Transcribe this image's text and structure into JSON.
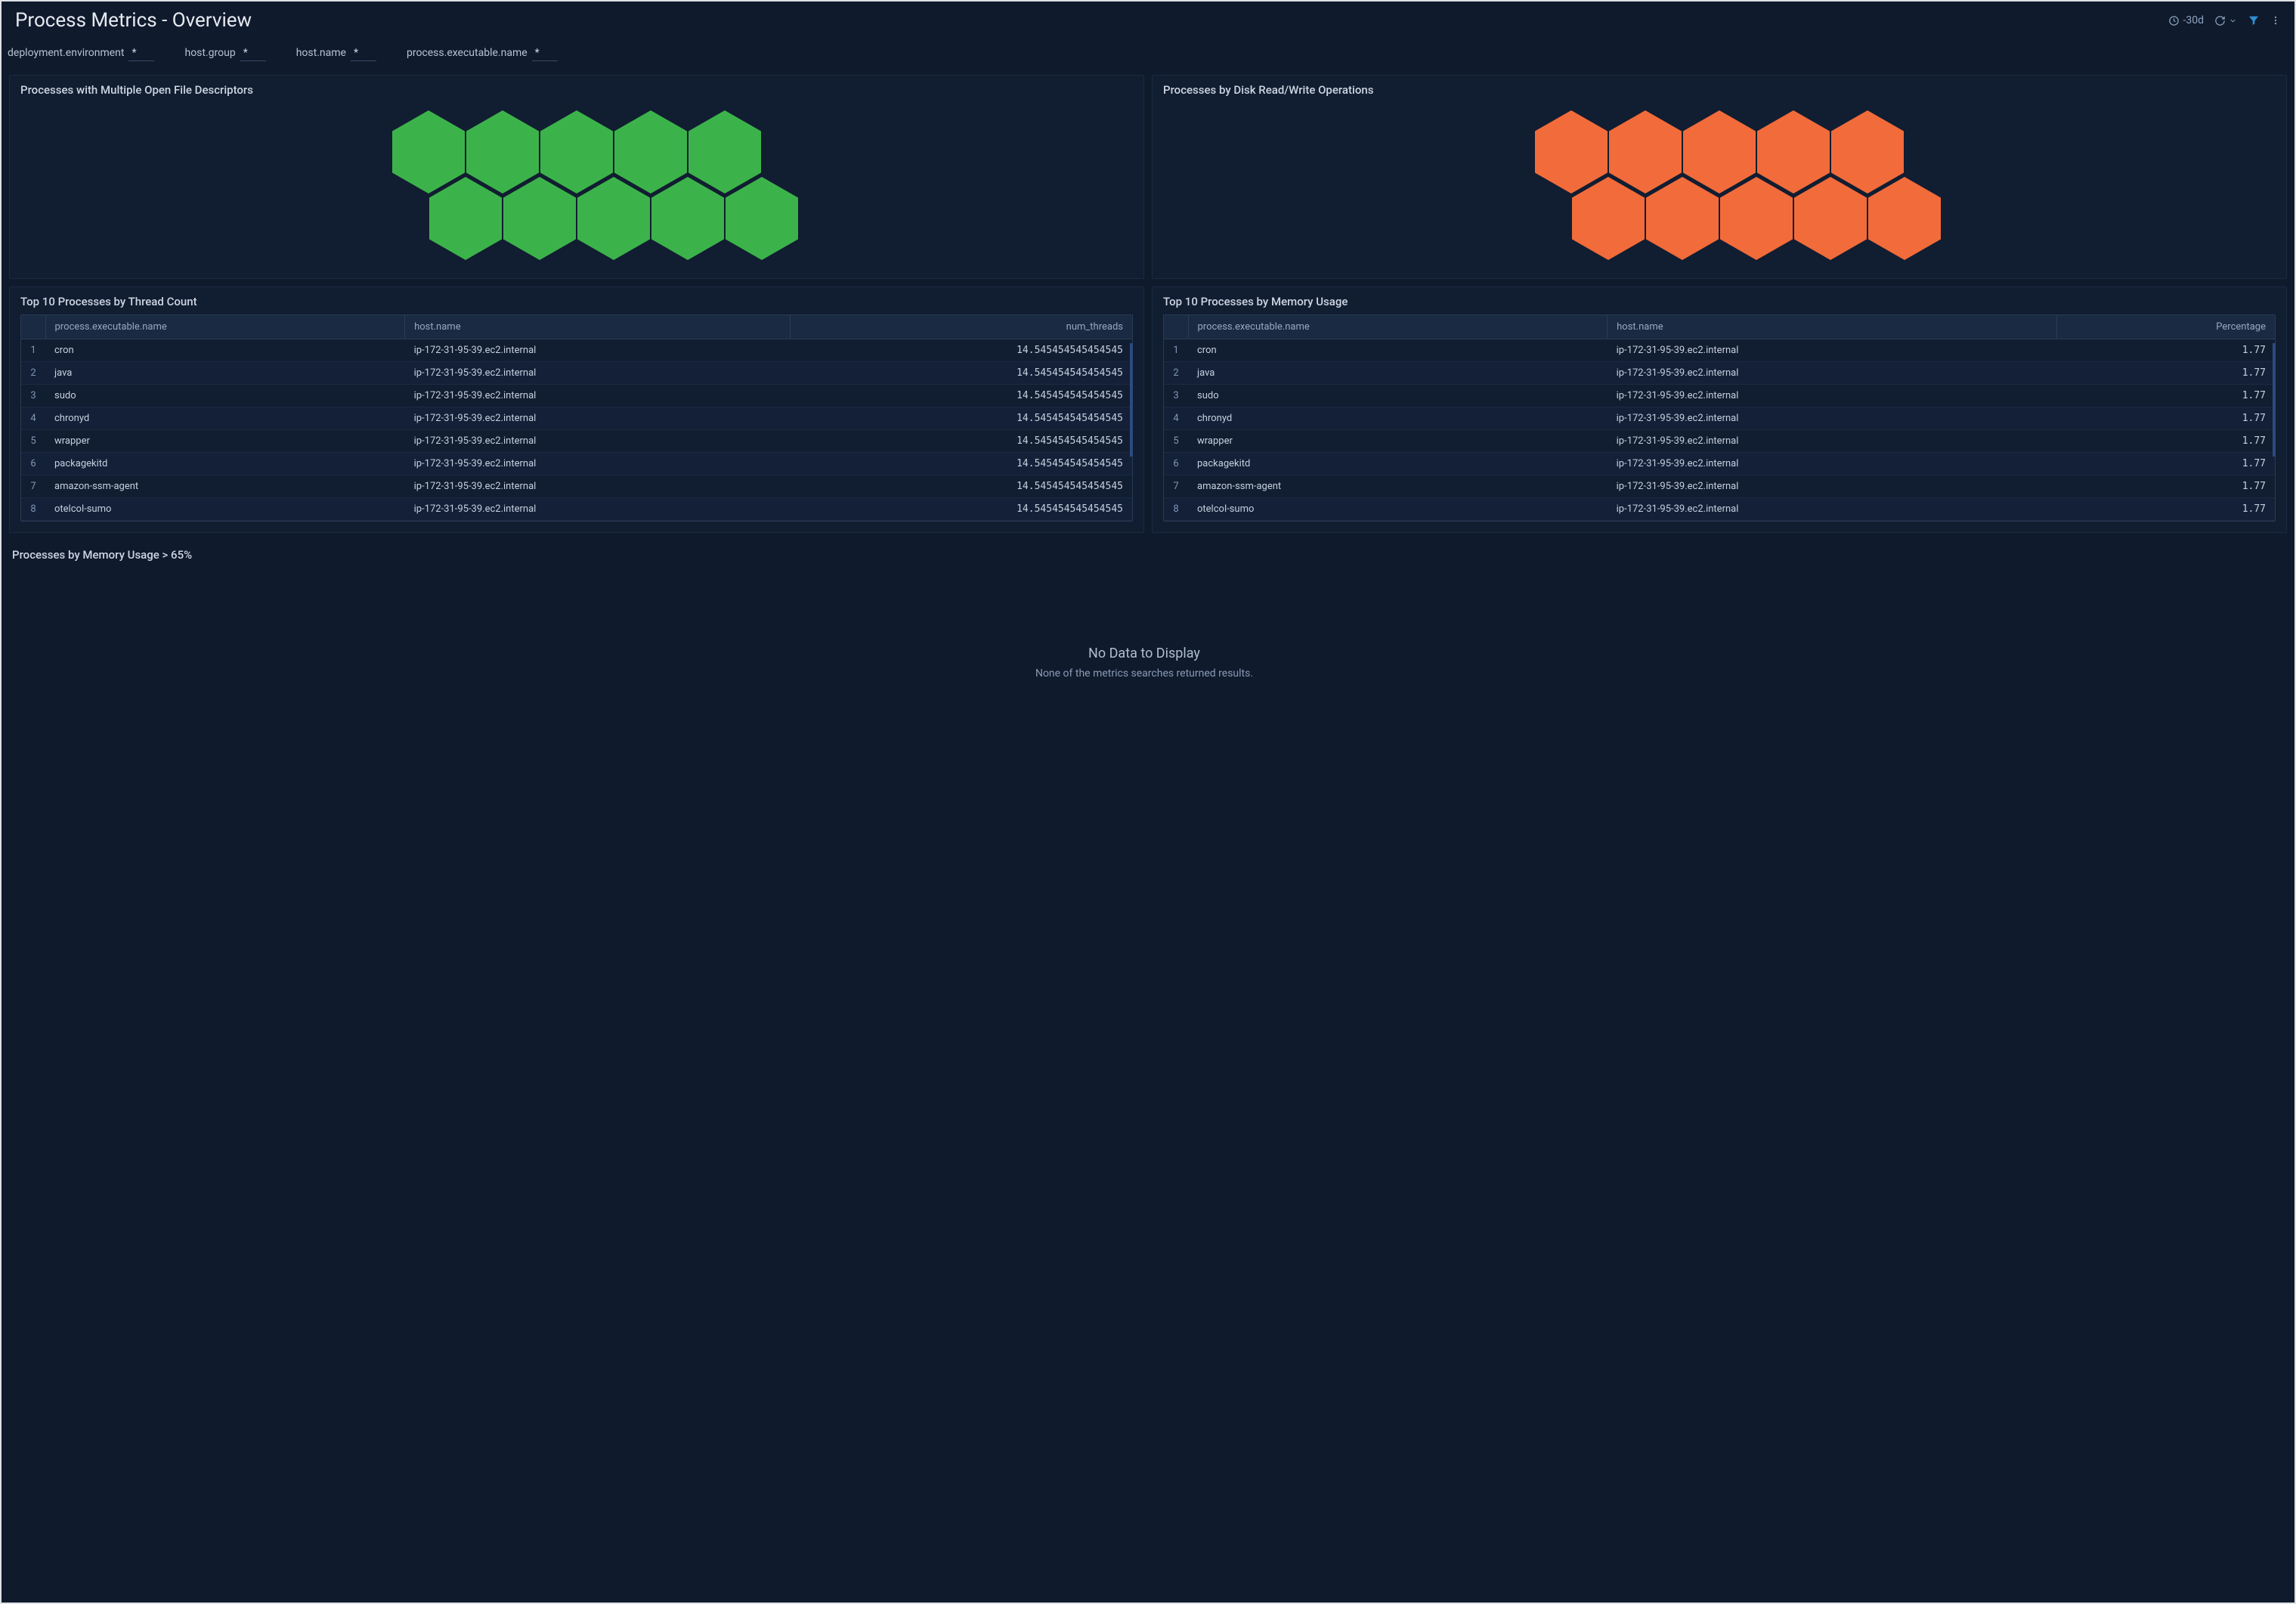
{
  "header": {
    "title": "Process Metrics - Overview",
    "time_range": "-30d"
  },
  "filters": [
    {
      "label": "deployment.environment",
      "value": "*"
    },
    {
      "label": "host.group",
      "value": "*"
    },
    {
      "label": "host.name",
      "value": "*"
    },
    {
      "label": "process.executable.name",
      "value": "*"
    }
  ],
  "panels": {
    "file_descriptors": {
      "title": "Processes with Multiple Open File Descriptors",
      "hex_color": "green",
      "rows": [
        5,
        5
      ]
    },
    "disk_ops": {
      "title": "Processes by Disk Read/Write Operations",
      "hex_color": "orange",
      "rows": [
        5,
        5
      ]
    },
    "thread_count": {
      "title": "Top 10 Processes by Thread Count",
      "columns": [
        "process.executable.name",
        "host.name",
        "num_threads"
      ],
      "rows": [
        [
          "cron",
          "ip-172-31-95-39.ec2.internal",
          "14.545454545454545"
        ],
        [
          "java",
          "ip-172-31-95-39.ec2.internal",
          "14.545454545454545"
        ],
        [
          "sudo",
          "ip-172-31-95-39.ec2.internal",
          "14.545454545454545"
        ],
        [
          "chronyd",
          "ip-172-31-95-39.ec2.internal",
          "14.545454545454545"
        ],
        [
          "wrapper",
          "ip-172-31-95-39.ec2.internal",
          "14.545454545454545"
        ],
        [
          "packagekitd",
          "ip-172-31-95-39.ec2.internal",
          "14.545454545454545"
        ],
        [
          "amazon-ssm-agent",
          "ip-172-31-95-39.ec2.internal",
          "14.545454545454545"
        ],
        [
          "otelcol-sumo",
          "ip-172-31-95-39.ec2.internal",
          "14.545454545454545"
        ]
      ]
    },
    "memory_usage": {
      "title": "Top 10 Processes by Memory Usage",
      "columns": [
        "process.executable.name",
        "host.name",
        "Percentage"
      ],
      "rows": [
        [
          "cron",
          "ip-172-31-95-39.ec2.internal",
          "1.77"
        ],
        [
          "java",
          "ip-172-31-95-39.ec2.internal",
          "1.77"
        ],
        [
          "sudo",
          "ip-172-31-95-39.ec2.internal",
          "1.77"
        ],
        [
          "chronyd",
          "ip-172-31-95-39.ec2.internal",
          "1.77"
        ],
        [
          "wrapper",
          "ip-172-31-95-39.ec2.internal",
          "1.77"
        ],
        [
          "packagekitd",
          "ip-172-31-95-39.ec2.internal",
          "1.77"
        ],
        [
          "amazon-ssm-agent",
          "ip-172-31-95-39.ec2.internal",
          "1.77"
        ],
        [
          "otelcol-sumo",
          "ip-172-31-95-39.ec2.internal",
          "1.77"
        ]
      ]
    },
    "memory_over_65": {
      "title": "Processes by Memory Usage > 65%",
      "no_data_title": "No Data to Display",
      "no_data_sub": "None of the metrics searches returned results."
    }
  },
  "chart_data": [
    {
      "type": "heatmap",
      "title": "Processes with Multiple Open File Descriptors",
      "cells": 10,
      "layout": [
        5,
        5
      ],
      "color": "#3cb34a"
    },
    {
      "type": "heatmap",
      "title": "Processes by Disk Read/Write Operations",
      "cells": 10,
      "layout": [
        5,
        5
      ],
      "color": "#f26b3a"
    },
    {
      "type": "table",
      "title": "Top 10 Processes by Thread Count",
      "columns": [
        "process.executable.name",
        "host.name",
        "num_threads"
      ],
      "rows": [
        [
          "cron",
          "ip-172-31-95-39.ec2.internal",
          14.545454545454545
        ],
        [
          "java",
          "ip-172-31-95-39.ec2.internal",
          14.545454545454545
        ],
        [
          "sudo",
          "ip-172-31-95-39.ec2.internal",
          14.545454545454545
        ],
        [
          "chronyd",
          "ip-172-31-95-39.ec2.internal",
          14.545454545454545
        ],
        [
          "wrapper",
          "ip-172-31-95-39.ec2.internal",
          14.545454545454545
        ],
        [
          "packagekitd",
          "ip-172-31-95-39.ec2.internal",
          14.545454545454545
        ],
        [
          "amazon-ssm-agent",
          "ip-172-31-95-39.ec2.internal",
          14.545454545454545
        ],
        [
          "otelcol-sumo",
          "ip-172-31-95-39.ec2.internal",
          14.545454545454545
        ]
      ]
    },
    {
      "type": "table",
      "title": "Top 10 Processes by Memory Usage",
      "columns": [
        "process.executable.name",
        "host.name",
        "Percentage"
      ],
      "rows": [
        [
          "cron",
          "ip-172-31-95-39.ec2.internal",
          1.77
        ],
        [
          "java",
          "ip-172-31-95-39.ec2.internal",
          1.77
        ],
        [
          "sudo",
          "ip-172-31-95-39.ec2.internal",
          1.77
        ],
        [
          "chronyd",
          "ip-172-31-95-39.ec2.internal",
          1.77
        ],
        [
          "wrapper",
          "ip-172-31-95-39.ec2.internal",
          1.77
        ],
        [
          "packagekitd",
          "ip-172-31-95-39.ec2.internal",
          1.77
        ],
        [
          "amazon-ssm-agent",
          "ip-172-31-95-39.ec2.internal",
          1.77
        ],
        [
          "otelcol-sumo",
          "ip-172-31-95-39.ec2.internal",
          1.77
        ]
      ]
    }
  ]
}
